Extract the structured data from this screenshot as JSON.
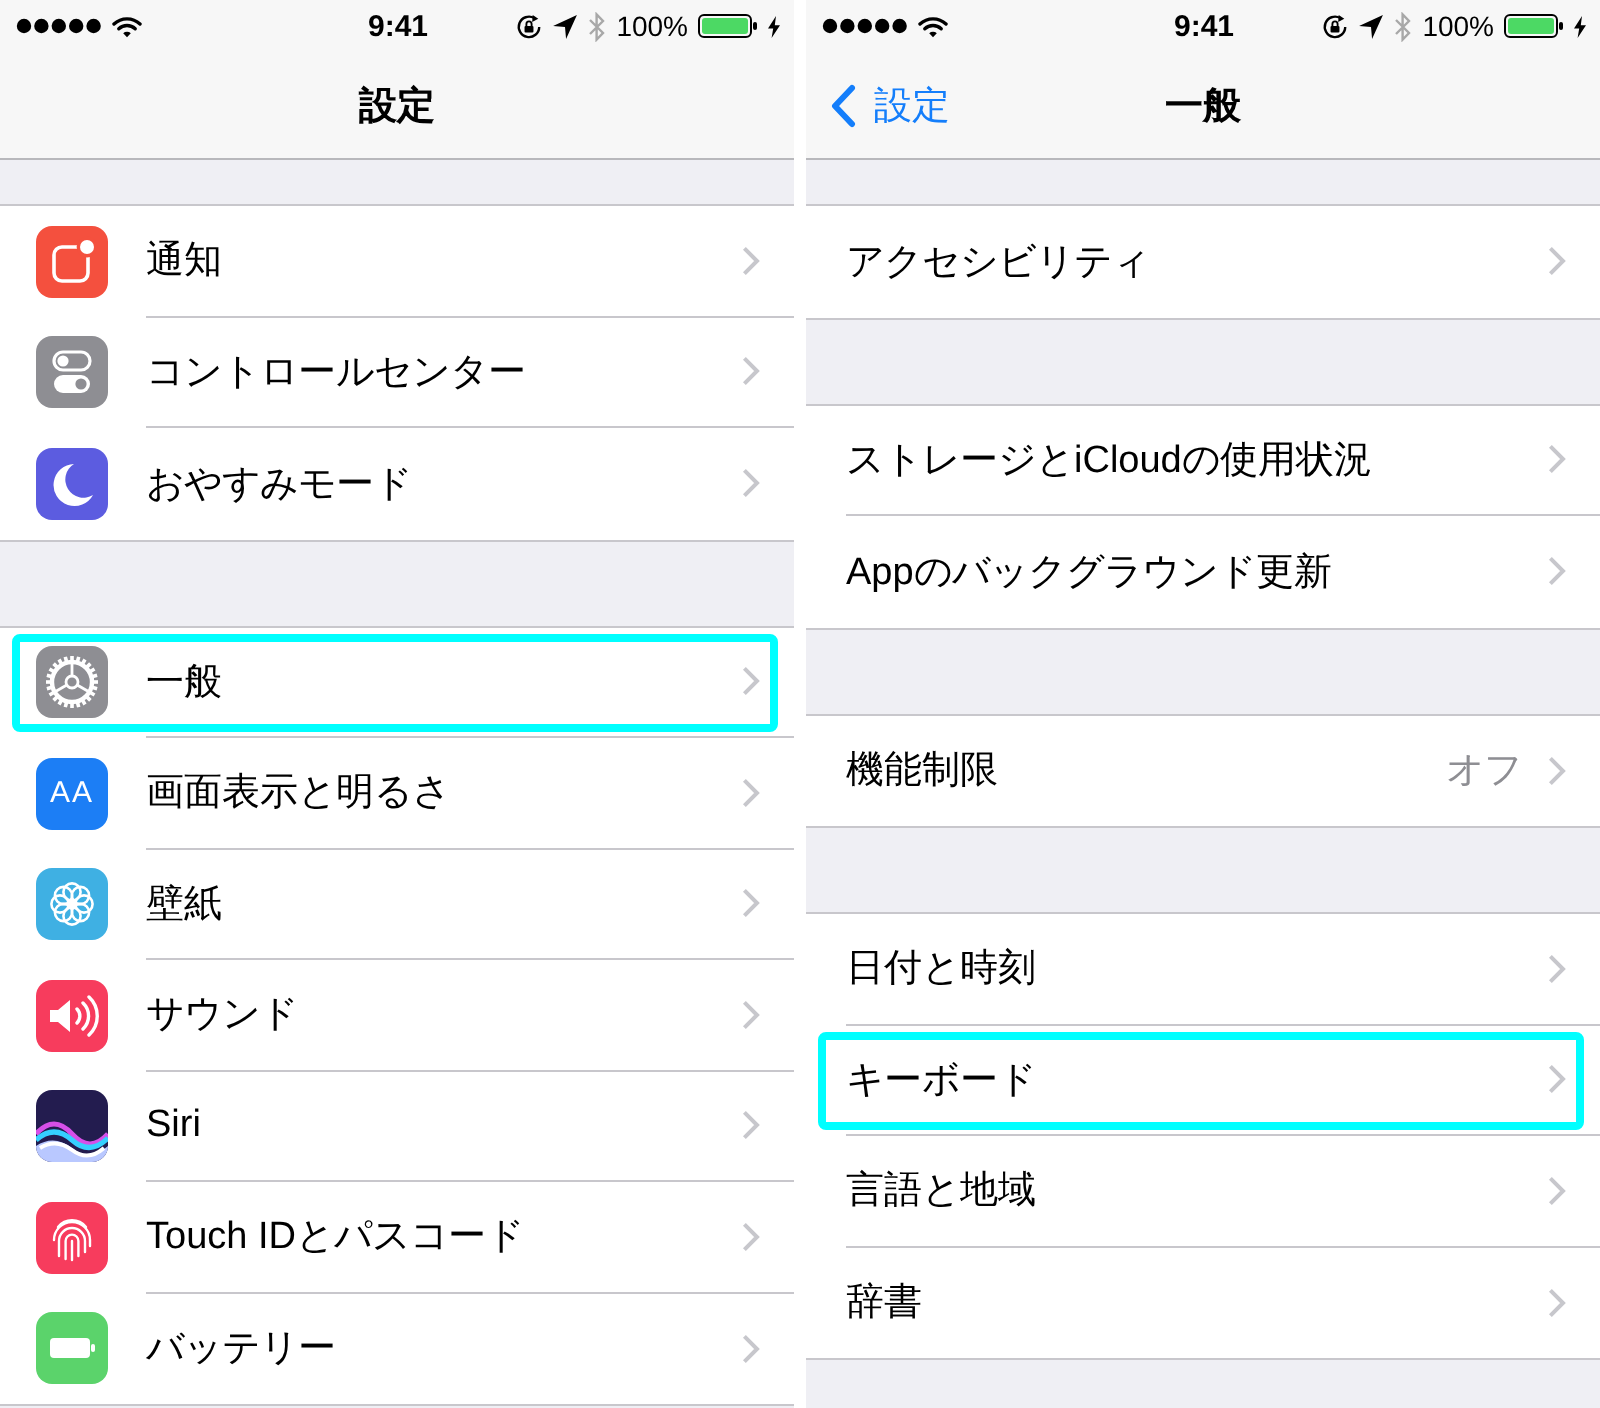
{
  "screens": [
    {
      "status_bar": {
        "time": "9:41",
        "battery_percent": "100%"
      },
      "nav_bar": {
        "title": "設定"
      },
      "groups": [
        {
          "items": [
            {
              "label": "通知",
              "kind": "notifications",
              "color": "#f4503e",
              "highlighted": false
            },
            {
              "label": "コントロールセンター",
              "kind": "toggles",
              "color": "#8e8e93",
              "highlighted": false
            },
            {
              "label": "おやすみモード",
              "kind": "moon",
              "color": "#5c5ce0",
              "highlighted": false
            }
          ]
        },
        {
          "items": [
            {
              "label": "一般",
              "kind": "gear",
              "color": "#8e8e93",
              "highlighted": true
            },
            {
              "label": "画面表示と明るさ",
              "kind": "letters",
              "glyph": "AA",
              "color": "#1c7ef5",
              "highlighted": false
            },
            {
              "label": "壁紙",
              "kind": "flower",
              "color": "#3fb0e3",
              "highlighted": false
            },
            {
              "label": "サウンド",
              "kind": "speaker",
              "color": "#f73c5d",
              "highlighted": false
            },
            {
              "label": "Siri",
              "kind": "siri",
              "color": "#231c4f",
              "highlighted": false
            },
            {
              "label": "Touch IDとパスコード",
              "kind": "fingerprint",
              "color": "#f73c5d",
              "highlighted": false
            },
            {
              "label": "バッテリー",
              "kind": "battery",
              "color": "#5bd36b",
              "highlighted": false
            }
          ]
        }
      ]
    },
    {
      "status_bar": {
        "time": "9:41",
        "battery_percent": "100%"
      },
      "nav_bar": {
        "back": "設定",
        "title": "一般"
      },
      "groups": [
        {
          "items": [
            {
              "label": "アクセシビリティ",
              "highlighted": false
            }
          ]
        },
        {
          "items": [
            {
              "label": "ストレージとiCloudの使用状況",
              "highlighted": false
            },
            {
              "label": "Appのバックグラウンド更新",
              "highlighted": false
            }
          ]
        },
        {
          "items": [
            {
              "label": "機能制限",
              "value": "オフ",
              "highlighted": false
            }
          ]
        },
        {
          "items": [
            {
              "label": "日付と時刻",
              "highlighted": false
            },
            {
              "label": "キーボード",
              "highlighted": true
            },
            {
              "label": "言語と地域",
              "highlighted": false
            },
            {
              "label": "辞書",
              "highlighted": false
            }
          ]
        }
      ]
    }
  ]
}
